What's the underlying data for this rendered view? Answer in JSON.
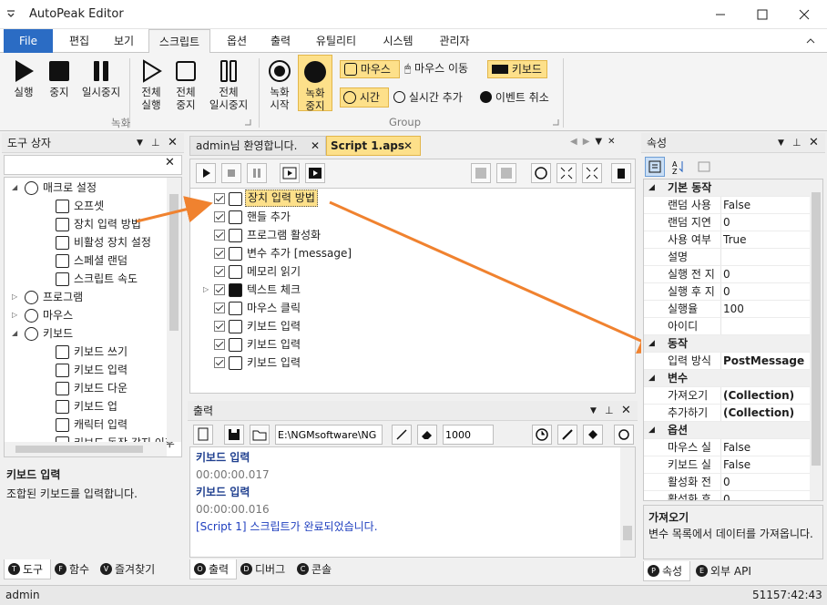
{
  "app": {
    "title": "AutoPeak Editor"
  },
  "ribbon_tabs": [
    "File",
    "편집",
    "보기",
    "스크립트",
    "옵션",
    "출력",
    "유틸리티",
    "시스템",
    "관리자"
  ],
  "ribbon": {
    "record": {
      "run": "실행",
      "stop": "중지",
      "pause": "일시중지",
      "all_run": "전체\n실행",
      "all_stop": "전체\n중지",
      "all_pause": "전체\n일시중지",
      "group": "녹화"
    },
    "group2": {
      "rec_start": "녹화\n시작",
      "rec_stop": "녹화\n중지",
      "mouse": "마우스",
      "mouse_move": "마우스 이동",
      "keyboard": "키보드",
      "time": "시간",
      "realtime_add": "실시간 추가",
      "event_cancel": "이벤트 취소",
      "group": "Group"
    }
  },
  "toolbox": {
    "title": "도구 상자",
    "search_placeholder": "",
    "items": [
      {
        "label": "매크로 설정",
        "indent": 0,
        "expand": "◢"
      },
      {
        "label": "오프셋",
        "indent": 1
      },
      {
        "label": "장치 입력 방법",
        "indent": 1
      },
      {
        "label": "비활성 장치 설정",
        "indent": 1
      },
      {
        "label": "스페셜 랜덤",
        "indent": 1
      },
      {
        "label": "스크립트 속도",
        "indent": 1
      },
      {
        "label": "프로그램",
        "indent": 0,
        "expand": "▷"
      },
      {
        "label": "마우스",
        "indent": 0,
        "expand": "▷"
      },
      {
        "label": "키보드",
        "indent": 0,
        "expand": "◢"
      },
      {
        "label": "키보드 쓰기",
        "indent": 1
      },
      {
        "label": "키보드 입력",
        "indent": 1
      },
      {
        "label": "키보드 다운",
        "indent": 1
      },
      {
        "label": "키보드 업",
        "indent": 1
      },
      {
        "label": "캐릭터 입력",
        "indent": 1
      },
      {
        "label": "키보드 동작 감지 이후",
        "indent": 1
      }
    ],
    "desc_title": "키보드 입력",
    "desc_text": "조합된 키보드를 입력합니다.",
    "bottom_tabs": [
      "도구",
      "함수",
      "즐겨찾기"
    ]
  },
  "editor": {
    "tabs": [
      "admin님 환영합니다.",
      "Script 1.aps"
    ],
    "lines": [
      {
        "label": "장치 입력 방법",
        "highlight": true
      },
      {
        "label": "핸들 추가"
      },
      {
        "label": "프로그램 활성화"
      },
      {
        "label": "변수 추가 [message]"
      },
      {
        "label": "메모리 읽기"
      },
      {
        "label": "텍스트 체크",
        "expand": true
      },
      {
        "label": "마우스 클릭"
      },
      {
        "label": "키보드 입력"
      },
      {
        "label": "키보드 입력"
      },
      {
        "label": "키보드 입력"
      }
    ]
  },
  "output": {
    "title": "출력",
    "path": "E:\\NGMsoftware\\NG",
    "number": "1000",
    "lines": [
      {
        "text": "키보드 입력",
        "kind": "bold"
      },
      {
        "text": "00:00:00.017",
        "kind": "time"
      },
      {
        "text": "키보드 입력",
        "kind": "bold"
      },
      {
        "text": "00:00:00.016",
        "kind": "time"
      },
      {
        "text": "[Script 1] 스크립트가 완료되었습니다.",
        "kind": "done"
      }
    ],
    "bottom_tabs": [
      "출력",
      "디버그",
      "콘솔"
    ]
  },
  "properties": {
    "title": "속성",
    "rows": [
      {
        "cat": "기본 동작"
      },
      {
        "k": "랜덤 사용",
        "v": "False"
      },
      {
        "k": "랜덤 지연",
        "v": "0"
      },
      {
        "k": "사용 여부",
        "v": "True"
      },
      {
        "k": "설명",
        "v": ""
      },
      {
        "k": "실행 전 지",
        "v": "0"
      },
      {
        "k": "실행 후 지",
        "v": "0"
      },
      {
        "k": "실행율",
        "v": "100"
      },
      {
        "k": "아이디",
        "v": ""
      },
      {
        "cat": "동작"
      },
      {
        "k": "입력 방식",
        "v": "PostMessage",
        "bold": true
      },
      {
        "cat": "변수"
      },
      {
        "k": "가져오기",
        "v": "(Collection)",
        "bold": true
      },
      {
        "k": "추가하기",
        "v": "(Collection)",
        "bold": true
      },
      {
        "cat": "옵션"
      },
      {
        "k": "마우스 실",
        "v": "False"
      },
      {
        "k": "키보드 실",
        "v": "False"
      },
      {
        "k": "활성화 전",
        "v": "0"
      },
      {
        "k": "활성화 후",
        "v": "0"
      }
    ],
    "desc_title": "가져오기",
    "desc_text": "변수 목록에서 데이터를 가져옵니다.",
    "bottom_tabs": [
      "속성",
      "외부 API"
    ]
  },
  "status": {
    "user": "admin",
    "time": "51157:42:43"
  },
  "colors": {
    "accent": "#2b6cc4",
    "highlight": "#fde08a",
    "arrow": "#f0822f"
  }
}
